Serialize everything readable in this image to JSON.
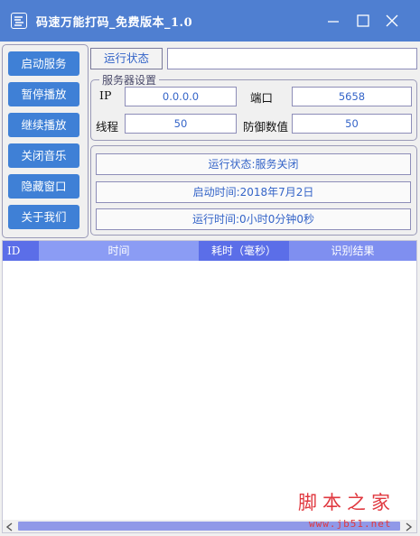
{
  "window": {
    "title": "码速万能打码_免费版本_1.0",
    "icons": {
      "app": "app-logo-icon",
      "minimize": "minimize-icon",
      "maximize": "maximize-icon",
      "close": "close-icon"
    },
    "colors": {
      "titlebar": "#4f7fd1",
      "button": "#3f80d6",
      "accent_text": "#3464c8",
      "table_header": "#7f8ff0"
    }
  },
  "sidebar": {
    "buttons": [
      {
        "label": "启动服务"
      },
      {
        "label": "暂停播放"
      },
      {
        "label": "继续播放"
      },
      {
        "label": "关闭音乐"
      },
      {
        "label": "隐藏窗口"
      },
      {
        "label": "关于我们"
      }
    ]
  },
  "status_bar": {
    "tab_label": "运行状态",
    "value": ""
  },
  "server_settings": {
    "group_title": "服务器设置",
    "ip_label": "IP",
    "ip_value": "0.0.0.0",
    "port_label": "端口",
    "port_value": "5658",
    "threads_label": "线程",
    "threads_value": "50",
    "defense_label": "防御数值",
    "defense_value": "50"
  },
  "info": {
    "run_status": "运行状态:服务关闭",
    "start_time": "启动时间:2018年7月2日",
    "run_time": "运行时间:0小时0分钟0秒"
  },
  "table": {
    "columns": [
      "ID",
      "时间",
      "耗时（毫秒）",
      "识别结果"
    ],
    "rows": []
  },
  "watermark": {
    "text": "脚本之家",
    "url": "www.jb51.net"
  }
}
